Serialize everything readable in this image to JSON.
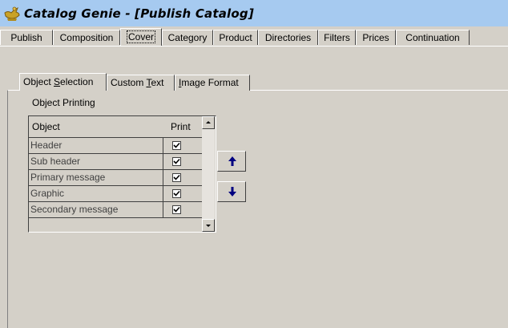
{
  "window": {
    "title": "Catalog Genie - [Publish Catalog]",
    "icon": "catalog-genie-app-icon",
    "title_bar_color": "#a6caf0"
  },
  "main_tabs": [
    {
      "label": "Publish"
    },
    {
      "label": "Composition"
    },
    {
      "label": "Cover",
      "active": true
    },
    {
      "label": "Category"
    },
    {
      "label": "Product"
    },
    {
      "label": "Directories"
    },
    {
      "label": "Filters"
    },
    {
      "label": "Prices"
    },
    {
      "label": "Continuation"
    }
  ],
  "sub_tabs": [
    {
      "pre": "Object ",
      "mnemonic": "S",
      "post": "election",
      "active": true
    },
    {
      "pre": "Custom ",
      "mnemonic": "T",
      "post": "ext"
    },
    {
      "pre": "",
      "mnemonic": "I",
      "post": "mage Format"
    }
  ],
  "object_printing": {
    "section_label": "Object Printing",
    "columns": {
      "object": "Object",
      "print": "Print"
    },
    "rows": [
      {
        "object": "Header",
        "print": true
      },
      {
        "object": "Sub header",
        "print": true
      },
      {
        "object": "Primary message",
        "print": true
      },
      {
        "object": "Graphic",
        "print": true
      },
      {
        "object": "Secondary message",
        "print": true
      }
    ]
  },
  "move_buttons": {
    "up_icon": "arrow-up-icon",
    "down_icon": "arrow-down-icon",
    "arrow_color": "#000080"
  }
}
